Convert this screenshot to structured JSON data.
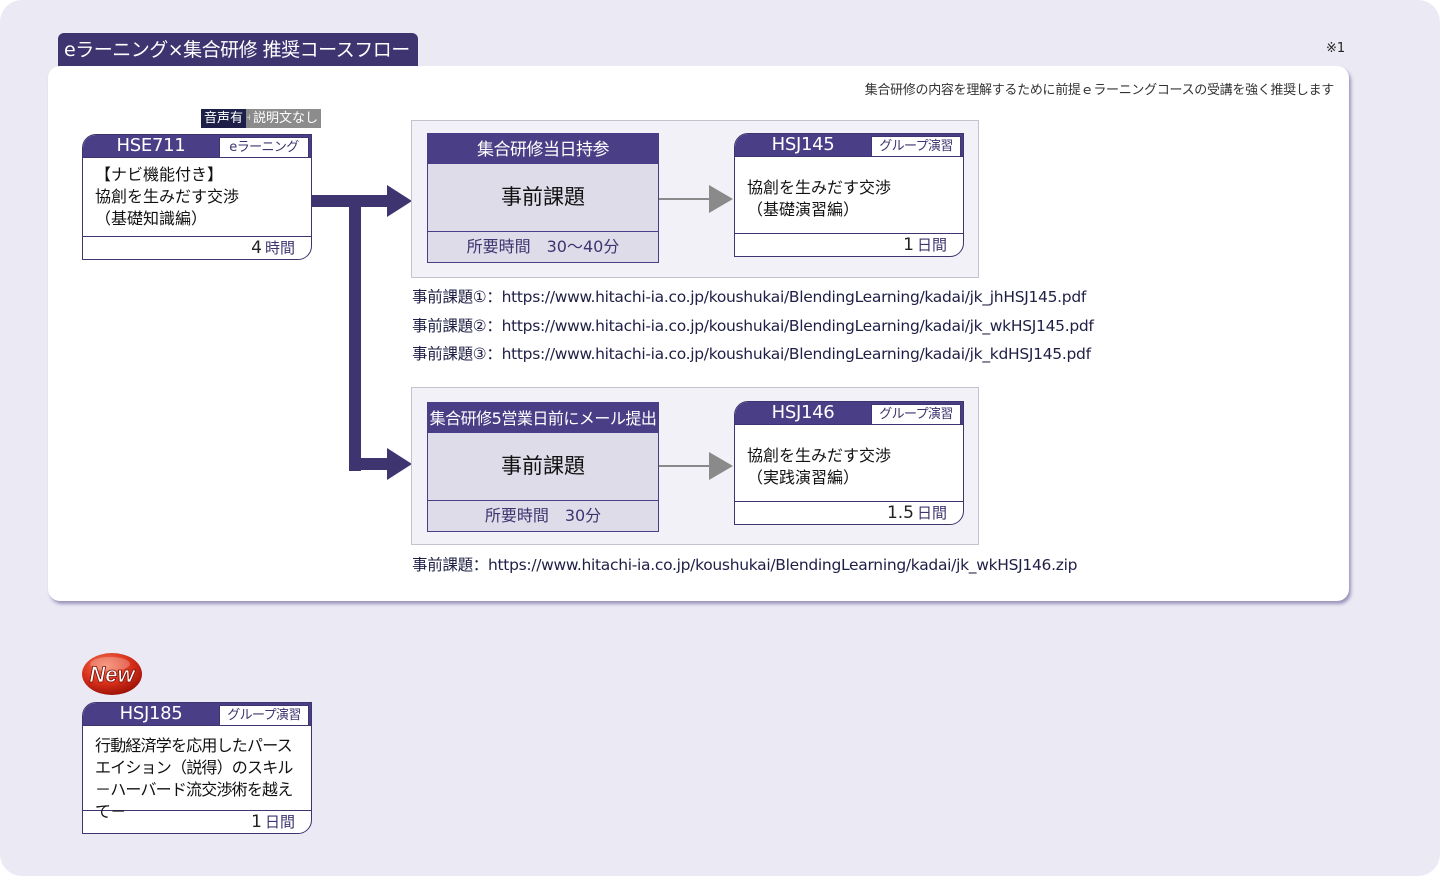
{
  "title": "eラーニング×集合研修 推奨コースフロー",
  "footnote_mark": "※1",
  "recommend_note": "集合研修の内容を理解するために前提ｅラーニングコースの受講を強く推奨します",
  "colors": {
    "primary": "#3e3470",
    "header": "#4a3f86",
    "page_bg": "#ebe9f4",
    "task_bg": "#dedce8",
    "arrow_gray": "#8a8a8a"
  },
  "prerequisite": {
    "badges": {
      "audio": "音声有",
      "plus": "+",
      "description": "説明文なし"
    },
    "code": "HSE711",
    "type": "eラーニング",
    "title_lines": [
      "【ナビ機能付き】",
      "協創を生みだす交渉",
      "（基礎知識編）"
    ],
    "duration_value": "4",
    "duration_unit": "時間"
  },
  "groups": [
    {
      "task": {
        "header": "集合研修当日持参",
        "title": "事前課題",
        "time": "所要時間　30～40分"
      },
      "course": {
        "code": "HSJ145",
        "type": "グループ演習",
        "title_lines": [
          "協創を生みだす交渉",
          "（基礎演習編）"
        ],
        "duration_value": "1",
        "duration_unit": "日間"
      },
      "urls": [
        "事前課題①：https://www.hitachi-ia.co.jp/koushukai/BlendingLearning/kadai/jk_jhHSJ145.pdf",
        "事前課題②：https://www.hitachi-ia.co.jp/koushukai/BlendingLearning/kadai/jk_wkHSJ145.pdf",
        "事前課題③：https://www.hitachi-ia.co.jp/koushukai/BlendingLearning/kadai/jk_kdHSJ145.pdf"
      ]
    },
    {
      "task": {
        "header": "集合研修5営業日前にメール提出",
        "title": "事前課題",
        "time": "所要時間　30分"
      },
      "course": {
        "code": "HSJ146",
        "type": "グループ演習",
        "title_lines": [
          "協創を生みだす交渉",
          "（実践演習編）"
        ],
        "duration_value": "1.5",
        "duration_unit": "日間"
      },
      "urls": [
        "事前課題：https://www.hitachi-ia.co.jp/koushukai/BlendingLearning/kadai/jk_wkHSJ146.zip"
      ]
    }
  ],
  "new_course": {
    "badge": "New",
    "code": "HSJ185",
    "type": "グループ演習",
    "title_lines": [
      "行動経済学を応用したパース",
      "エイション（説得）のスキル",
      "－ハーバード流交渉術を越えて－"
    ],
    "duration_value": "1",
    "duration_unit": "日間"
  }
}
